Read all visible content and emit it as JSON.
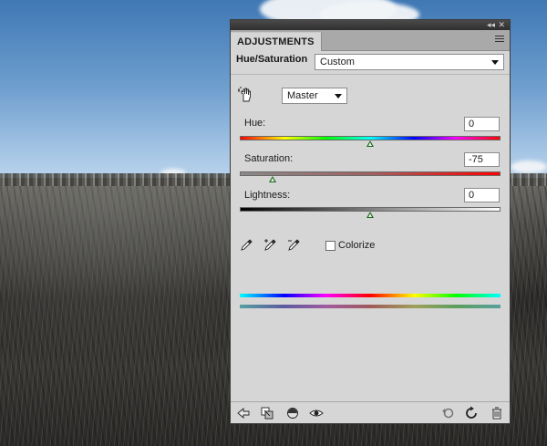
{
  "panel": {
    "tab_label": "ADJUSTMENTS",
    "adjustment_label": "Hue/Saturation",
    "preset_value": "Custom",
    "channel_value": "Master"
  },
  "controls": {
    "hue": {
      "label": "Hue:",
      "value": "0",
      "fraction": 0.5
    },
    "saturation": {
      "label": "Saturation:",
      "value": "-75",
      "fraction": 0.125
    },
    "lightness": {
      "label": "Lightness:",
      "value": "0",
      "fraction": 0.5
    }
  },
  "colorize": {
    "label": "Colorize",
    "checked": false
  },
  "icons": {
    "titlebar": [
      "collapse-arrows-icon",
      "close-icon"
    ],
    "tools": [
      "targeted-adjustment-hand-icon",
      "eyedropper-icon",
      "eyedropper-plus-icon",
      "eyedropper-minus-icon"
    ],
    "footer": [
      "back-arrow-icon",
      "clip-to-layer-icon",
      "view-previous-state-icon",
      "visibility-eye-icon",
      "reset-icon",
      "refresh-icon",
      "trash-icon"
    ]
  },
  "colors": {
    "panel_bg": "#d6d6d6",
    "slider_thumb": "#1e6a1e"
  }
}
